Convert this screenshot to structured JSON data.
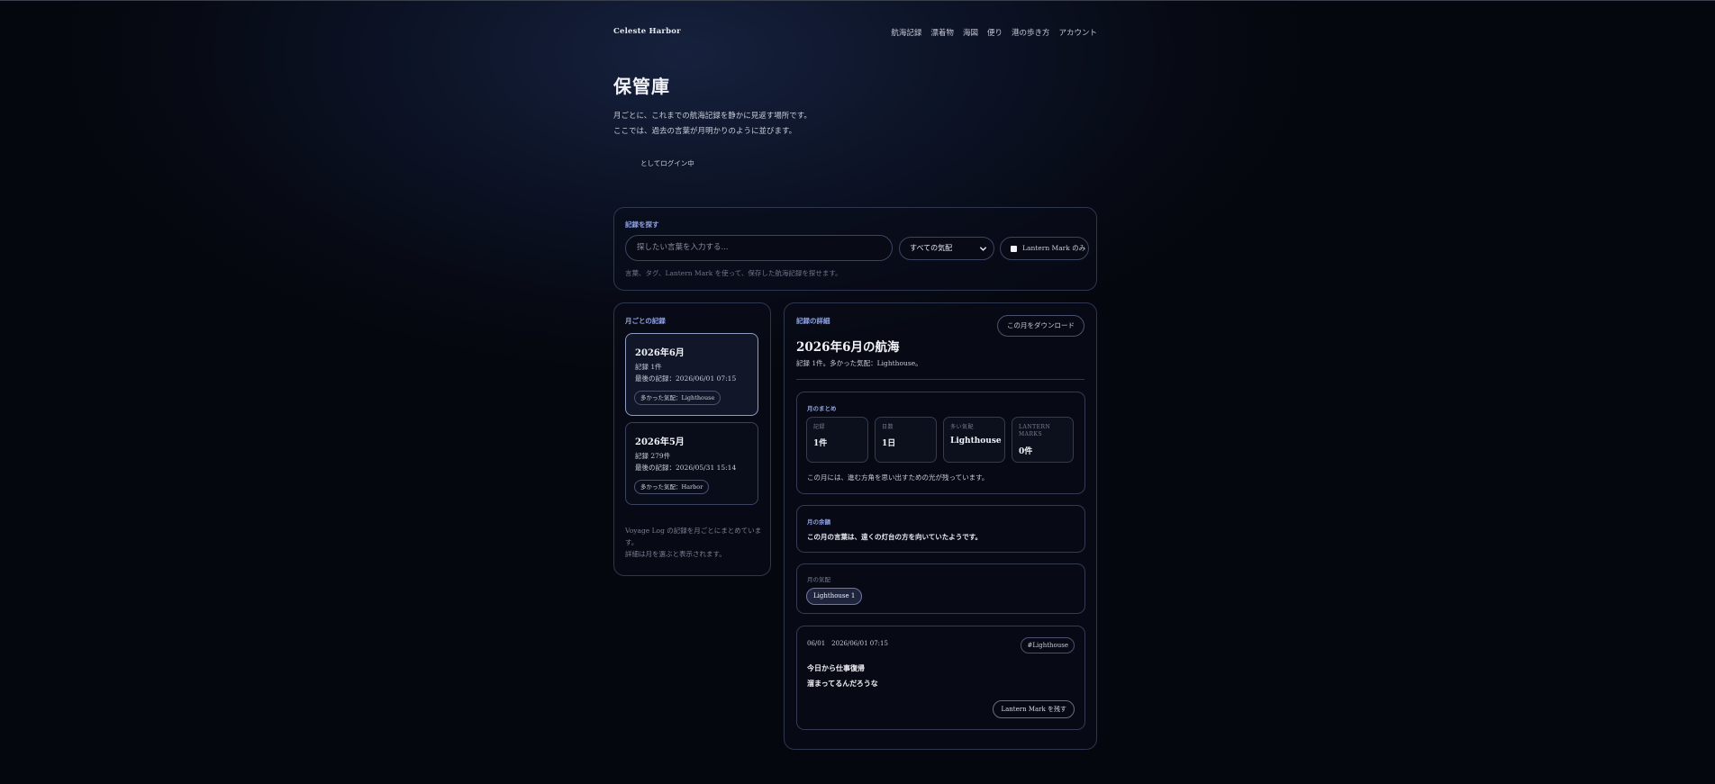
{
  "brand": "Celeste Harbor",
  "nav": [
    "航海記録",
    "漂着物",
    "海図",
    "便り",
    "港の歩き方",
    "アカウント"
  ],
  "page": {
    "title": "保管庫",
    "intro_line1": "月ごとに、これまでの航海記録を静かに見返す場所です。",
    "intro_line2": "ここでは、過去の言葉が月明かりのように並びます。",
    "login_suffix": "としてログイン中"
  },
  "search": {
    "label": "記録を探す",
    "placeholder": "探したい言葉を入力する...",
    "mood_select": "すべての気配",
    "lantern_only": "Lantern Mark のみ",
    "hint": "言葉、タグ、Lantern Mark を使って、保存した航海記録を探せます。"
  },
  "months": {
    "label": "月ごとの記録",
    "items": [
      {
        "title": "2026年6月",
        "count": "記録 1件",
        "last": "最後の記録：2026/06/01 07:15",
        "badge": "多かった気配：Lighthouse"
      },
      {
        "title": "2026年5月",
        "count": "記録 279件",
        "last": "最後の記録：2026/05/31 15:14",
        "badge": "多かった気配：Harbor"
      }
    ],
    "note_line1": "Voyage Log の記録を月ごとにまとめていま",
    "note_line2": "す。",
    "note_line3": "詳細は月を選ぶと表示されます。"
  },
  "detail": {
    "label": "記録の詳細",
    "download": "この月をダウンロード",
    "title": "2026年6月の航海",
    "subtitle": "記録 1件。多かった気配：Lighthouse。",
    "summary": {
      "label": "月のまとめ",
      "stats": [
        {
          "label": "記録",
          "value": "1件"
        },
        {
          "label": "日数",
          "value": "1日"
        },
        {
          "label": "多い気配",
          "value": "Lighthouse"
        },
        {
          "label1": "LANTERN",
          "label2": "MARKS",
          "value": "0件"
        }
      ],
      "note": "この月には、進む方角を思い出すための光が残っています。"
    },
    "afterglow": {
      "label": "月の余韻",
      "text": "この月の言葉は、遠くの灯台の方を向いていたようです。"
    },
    "moods": {
      "label": "月の気配",
      "chip": "Lighthouse 1"
    },
    "entry": {
      "meta": "06/01　2026/06/01 07:15",
      "tag": "#Lighthouse",
      "line1": "今日から仕事復帰",
      "line2": "溜まってるんだろうな",
      "button": "Lantern Mark を残す"
    }
  }
}
